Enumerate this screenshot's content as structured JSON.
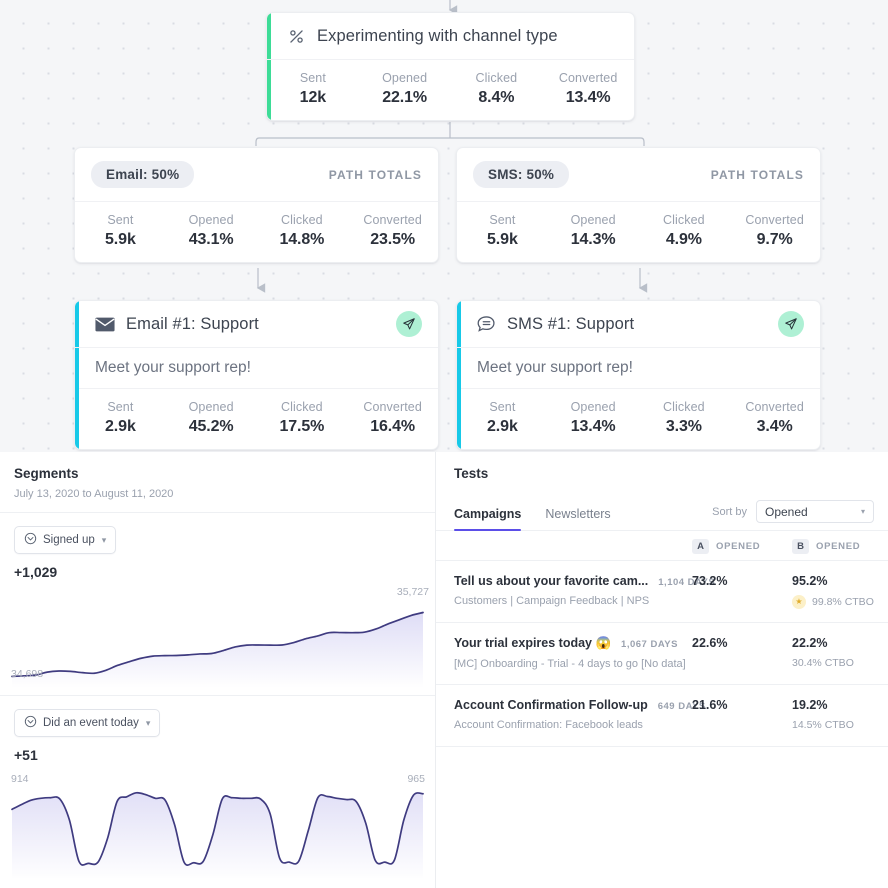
{
  "flow": {
    "split_node": {
      "icon": "percent-split-icon",
      "title": "Experimenting with channel type",
      "accent_color": "#3ddc97",
      "stats": [
        {
          "label": "Sent",
          "value": "12k"
        },
        {
          "label": "Opened",
          "value": "22.1%"
        },
        {
          "label": "Clicked",
          "value": "8.4%"
        },
        {
          "label": "Converted",
          "value": "13.4%"
        }
      ]
    },
    "branches": [
      {
        "pill": "Email: 50%",
        "path_totals_label": "PATH TOTALS",
        "stats": [
          {
            "label": "Sent",
            "value": "5.9k"
          },
          {
            "label": "Opened",
            "value": "43.1%"
          },
          {
            "label": "Clicked",
            "value": "14.8%"
          },
          {
            "label": "Converted",
            "value": "23.5%"
          }
        ]
      },
      {
        "pill": "SMS: 50%",
        "path_totals_label": "PATH TOTALS",
        "stats": [
          {
            "label": "Sent",
            "value": "5.9k"
          },
          {
            "label": "Opened",
            "value": "14.3%"
          },
          {
            "label": "Clicked",
            "value": "4.9%"
          },
          {
            "label": "Converted",
            "value": "9.7%"
          }
        ]
      }
    ],
    "messages": [
      {
        "icon": "envelope-icon",
        "title": "Email #1: Support",
        "subject": "Meet your support rep!",
        "accent_color": "#17c9e8",
        "badge_icon": "send-paper-plane-icon",
        "stats": [
          {
            "label": "Sent",
            "value": "2.9k"
          },
          {
            "label": "Opened",
            "value": "45.2%"
          },
          {
            "label": "Clicked",
            "value": "17.5%"
          },
          {
            "label": "Converted",
            "value": "16.4%"
          }
        ]
      },
      {
        "icon": "chat-bubble-icon",
        "title": "SMS #1: Support",
        "subject": "Meet your support rep!",
        "accent_color": "#17c9e8",
        "badge_icon": "send-paper-plane-icon",
        "stats": [
          {
            "label": "Sent",
            "value": "2.9k"
          },
          {
            "label": "Opened",
            "value": "13.4%"
          },
          {
            "label": "Clicked",
            "value": "3.3%"
          },
          {
            "label": "Converted",
            "value": "3.4%"
          }
        ]
      }
    ]
  },
  "segments": {
    "title": "Segments",
    "date_range": "July 13, 2020 to August 11, 2020",
    "blocks": [
      {
        "chip_label": "Signed up",
        "chip_icon": "target-circle-icon",
        "delta": "+1,029",
        "start_label": "34,698",
        "end_label": "35,727"
      },
      {
        "chip_label": "Did an event today",
        "chip_icon": "target-circle-icon",
        "delta": "+51",
        "start_label": "914",
        "end_label": "965"
      }
    ]
  },
  "tests": {
    "title": "Tests",
    "tabs": [
      {
        "label": "Campaigns",
        "active": true
      },
      {
        "label": "Newsletters",
        "active": false
      }
    ],
    "sort_label": "Sort by",
    "sort_value": "Opened",
    "columns": [
      {
        "badge": "A",
        "label": "OPENED"
      },
      {
        "badge": "B",
        "label": "OPENED"
      }
    ],
    "rows": [
      {
        "name": "Tell us about your favorite cam...",
        "days": "1,104 DAYS",
        "desc": "Customers | Campaign Feedback | NPS",
        "a_value": "73.2%",
        "b_value": "95.2%",
        "ctbo": "99.8% CTBO",
        "winner": true
      },
      {
        "name": "Your trial expires today 😱",
        "days": "1,067 DAYS",
        "desc": "[MC] Onboarding - Trial - 4 days to go [No data]",
        "a_value": "22.6%",
        "b_value": "22.2%",
        "ctbo": "30.4% CTBO",
        "winner": false
      },
      {
        "name": "Account Confirmation Follow-up",
        "days": "649 DAYS",
        "desc": "Account Confirmation: Facebook leads",
        "a_value": "21.6%",
        "b_value": "19.2%",
        "ctbo": "14.5% CTBO",
        "winner": false
      }
    ]
  },
  "chart_data": [
    {
      "type": "area",
      "title": "Signed up",
      "xlabel": "",
      "ylabel": "",
      "start_label": "34,698",
      "end_label": "35,727",
      "ylim": [
        34600,
        35800
      ],
      "grid": false,
      "legend": "none",
      "values": [
        34690,
        34700,
        34712,
        34760,
        34778,
        34772,
        34752,
        34742,
        34790,
        34870,
        34930,
        34985,
        35020,
        35028,
        35030,
        35040,
        35055,
        35062,
        35110,
        35168,
        35198,
        35200,
        35198,
        35200,
        35240,
        35300,
        35345,
        35400,
        35402,
        35400,
        35408,
        35460,
        35540,
        35610,
        35680,
        35727
      ]
    },
    {
      "type": "area",
      "title": "Did an event today",
      "xlabel": "",
      "ylabel": "",
      "start_label": "914",
      "end_label": "965",
      "ylim": [
        700,
        1000
      ],
      "grid": false,
      "legend": "none",
      "values": [
        914,
        930,
        944,
        950,
        952,
        948,
        880,
        745,
        738,
        742,
        820,
        940,
        955,
        968,
        962,
        950,
        945,
        865,
        742,
        740,
        744,
        830,
        948,
        952,
        950,
        950,
        948,
        900,
        755,
        742,
        745,
        845,
        952,
        956,
        950,
        946,
        940,
        870,
        748,
        742,
        748,
        880,
        960,
        965
      ]
    }
  ]
}
